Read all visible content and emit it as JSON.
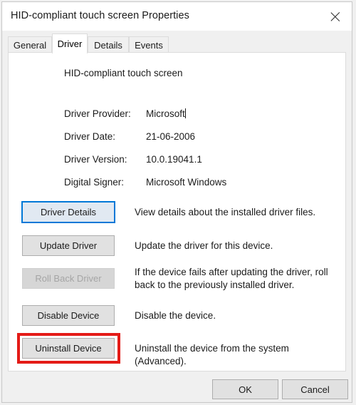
{
  "window": {
    "title": "HID-compliant touch screen  Properties",
    "close_icon": "close-icon"
  },
  "tabs": [
    {
      "label": "General",
      "active": false
    },
    {
      "label": "Driver",
      "active": true
    },
    {
      "label": "Details",
      "active": false
    },
    {
      "label": "Events",
      "active": false
    }
  ],
  "driver_panel": {
    "device_name": "HID-compliant touch screen",
    "info": [
      {
        "label": "Driver Provider:",
        "value": "Microsoft",
        "caret": true
      },
      {
        "label": "Driver Date:",
        "value": "21-06-2006",
        "caret": false
      },
      {
        "label": "Driver Version:",
        "value": "10.0.19041.1",
        "caret": false
      },
      {
        "label": "Digital Signer:",
        "value": "Microsoft Windows",
        "caret": false
      }
    ],
    "actions": [
      {
        "label": "Driver Details",
        "description": "View details about the installed driver files.",
        "state": "focused"
      },
      {
        "label": "Update Driver",
        "description": "Update the driver for this device.",
        "state": "normal"
      },
      {
        "label": "Roll Back Driver",
        "description": "If the device fails after updating the driver, roll back to the previously installed driver.",
        "state": "disabled"
      },
      {
        "label": "Disable Device",
        "description": "Disable the device.",
        "state": "normal"
      },
      {
        "label": "Uninstall Device",
        "description": "Uninstall the device from the system (Advanced).",
        "state": "highlighted"
      }
    ]
  },
  "footer": {
    "ok_label": "OK",
    "cancel_label": "Cancel"
  },
  "colors": {
    "annotation_red": "#e41b17",
    "focus_blue": "#0078d7",
    "button_face": "#e1e1e1",
    "dialog_background": "#f0f0f0"
  }
}
